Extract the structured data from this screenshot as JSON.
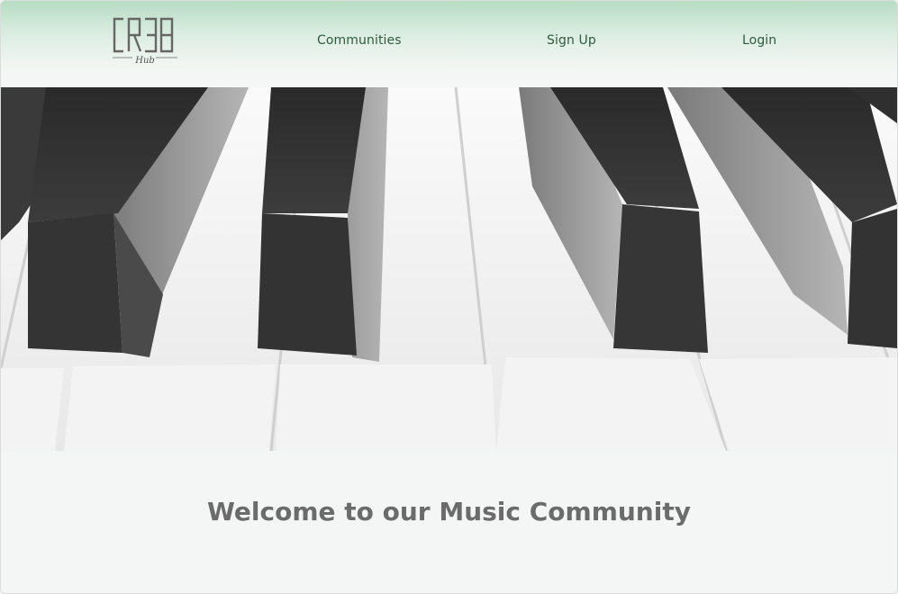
{
  "header": {
    "logo": {
      "letters": "CR3B",
      "subtext": "Hub"
    },
    "nav": [
      {
        "label": "Communities"
      },
      {
        "label": "Sign Up"
      },
      {
        "label": "Login"
      }
    ]
  },
  "hero": {
    "image": "piano-keys-photo"
  },
  "welcome": {
    "title": "Welcome to our Music Community"
  },
  "colors": {
    "header_top": "#b7dcc4",
    "nav_text": "#2f5a3b",
    "title_text": "#6b6b6b",
    "background": "#f4f6f5"
  }
}
